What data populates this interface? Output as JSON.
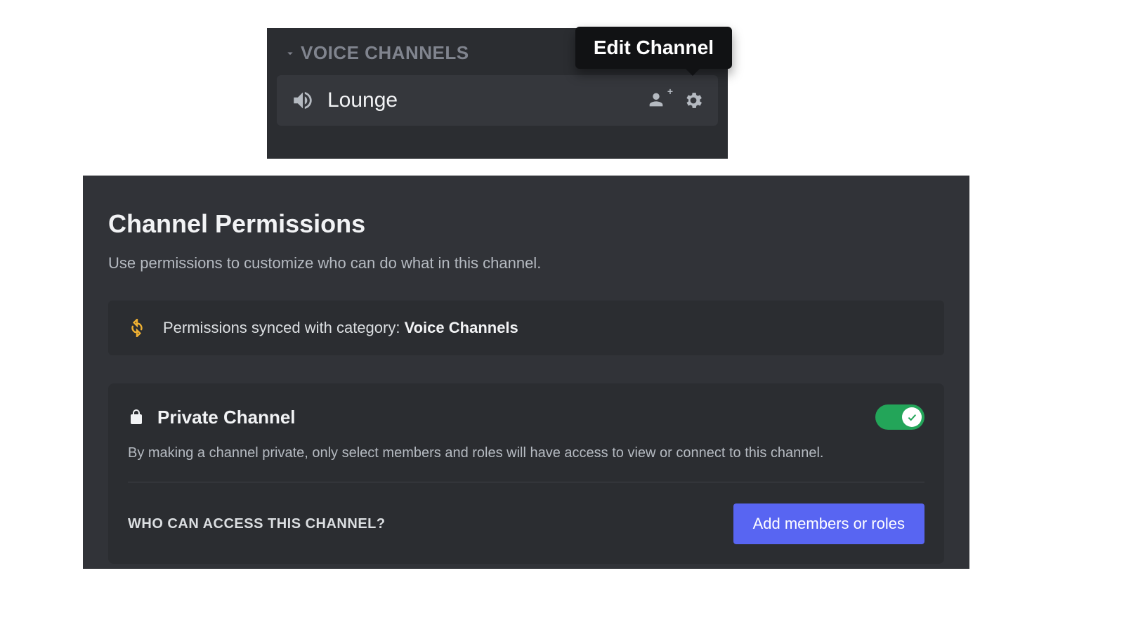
{
  "channel_list": {
    "category_label": "VOICE CHANNELS",
    "channel_name": "Lounge",
    "tooltip": "Edit Channel"
  },
  "permissions": {
    "title": "Channel Permissions",
    "subtitle": "Use permissions to customize who can do what in this channel.",
    "sync_prefix": "Permissions synced with category: ",
    "sync_category": "Voice Channels",
    "private": {
      "label": "Private Channel",
      "description": "By making a channel private, only select members and roles will have access to view or connect to this channel.",
      "enabled": true
    },
    "access_label": "WHO CAN ACCESS THIS CHANNEL?",
    "add_button": "Add members or roles"
  }
}
